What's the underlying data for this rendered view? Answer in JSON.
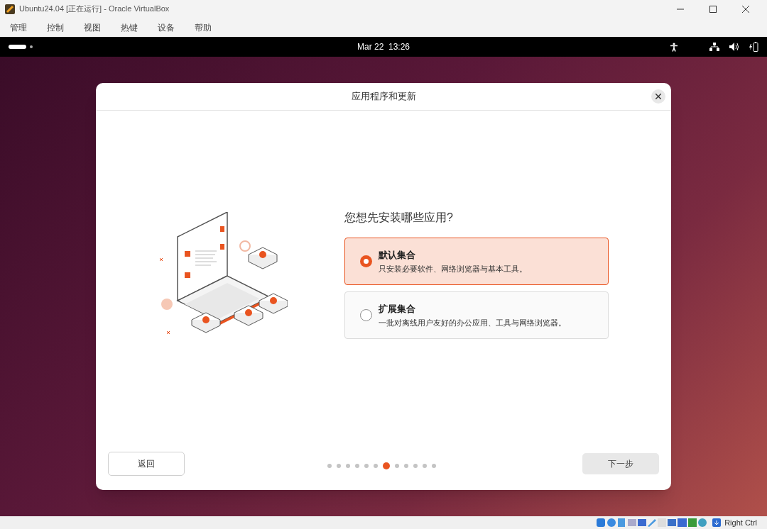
{
  "window": {
    "title": "Ubuntu24.04 [正在运行] - Oracle VirtualBox"
  },
  "menu": [
    "管理",
    "控制",
    "视图",
    "热键",
    "设备",
    "帮助"
  ],
  "top_bar": {
    "clock": "Mar 22  13:26"
  },
  "dialog": {
    "title": "应用程序和更新",
    "question": "您想先安装哪些应用?",
    "options": [
      {
        "title": "默认集合",
        "description": "只安装必要软件、网络浏览器与基本工具。",
        "selected": true
      },
      {
        "title": "扩展集合",
        "description": "一批对离线用户友好的办公应用、工具与网络浏览器。",
        "selected": false
      }
    ],
    "steps": [
      {
        "selected": false
      },
      {
        "selected": false
      },
      {
        "selected": false
      },
      {
        "selected": false
      },
      {
        "selected": false
      },
      {
        "selected": false
      },
      {
        "selected": true
      },
      {
        "selected": false
      },
      {
        "selected": false
      },
      {
        "selected": false
      },
      {
        "selected": false
      },
      {
        "selected": false
      }
    ],
    "back_button": "返回",
    "next_button": "下一步"
  },
  "status_bar": {
    "host_key": "Right Ctrl"
  }
}
